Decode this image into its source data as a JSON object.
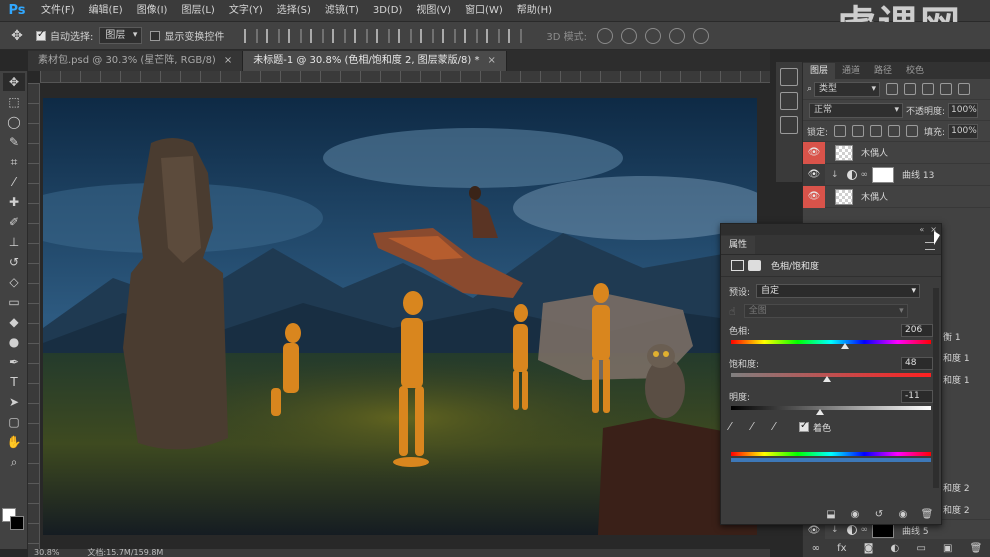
{
  "app": {
    "logo": "Ps"
  },
  "menu": [
    "文件(F)",
    "编辑(E)",
    "图像(I)",
    "图层(L)",
    "文字(Y)",
    "选择(S)",
    "滤镜(T)",
    "3D(D)",
    "视图(V)",
    "窗口(W)",
    "帮助(H)"
  ],
  "watermark": "虎课网",
  "options": {
    "auto_select_label": "自动选择:",
    "auto_select_value": "图层",
    "show_transform_label": "显示变换控件",
    "mode3d_label": "3D 模式:"
  },
  "tabs": [
    {
      "label": "素材包.psd @ 30.3% (星芒阵, RGB/8)",
      "active": false
    },
    {
      "label": "未标题-1 @ 30.8% (色相/饱和度 2, 图层蒙版/8) *",
      "active": true
    }
  ],
  "status": {
    "zoom": "30.8%",
    "doc": "文档:15.7M/159.8M"
  },
  "layers": {
    "tabs": [
      "图层",
      "通道",
      "路径",
      "校色"
    ],
    "filter": "类型",
    "blend_mode": "正常",
    "opacity_label": "不透明度:",
    "opacity_value": "100%",
    "lock_label": "锁定:",
    "fill_label": "填充:",
    "fill_value": "100%",
    "rows": [
      {
        "name": "木偶人",
        "type": "smart",
        "eye": "red"
      },
      {
        "name": "曲线 13",
        "type": "adjust",
        "eye": "dark"
      },
      {
        "name": "木偶人",
        "type": "smart",
        "eye": "red"
      }
    ],
    "partial_names": [
      "衡 1",
      "和度 1",
      "和度 1",
      "和度 2",
      "和度 2"
    ],
    "bottom_row_name": "曲线 5"
  },
  "properties": {
    "tab": "属性",
    "title": "色相/饱和度",
    "preset_label": "预设:",
    "preset_value": "自定",
    "channel_value": "全图",
    "hue_label": "色相:",
    "hue_value": "206",
    "hue_level": 206,
    "hue_range": [
      0,
      360
    ],
    "saturation_label": "饱和度:",
    "saturation_value": "48",
    "saturation_level": 48,
    "saturation_range": [
      0,
      100
    ],
    "lightness_label": "明度:",
    "lightness_value": "-11",
    "lightness_level": -11,
    "lightness_range": [
      -100,
      100
    ],
    "colorize_label": "着色",
    "colorize_checked": true
  },
  "colors": {
    "accent_red": "#d9534a",
    "colorize_bar": "#3d78b8"
  }
}
